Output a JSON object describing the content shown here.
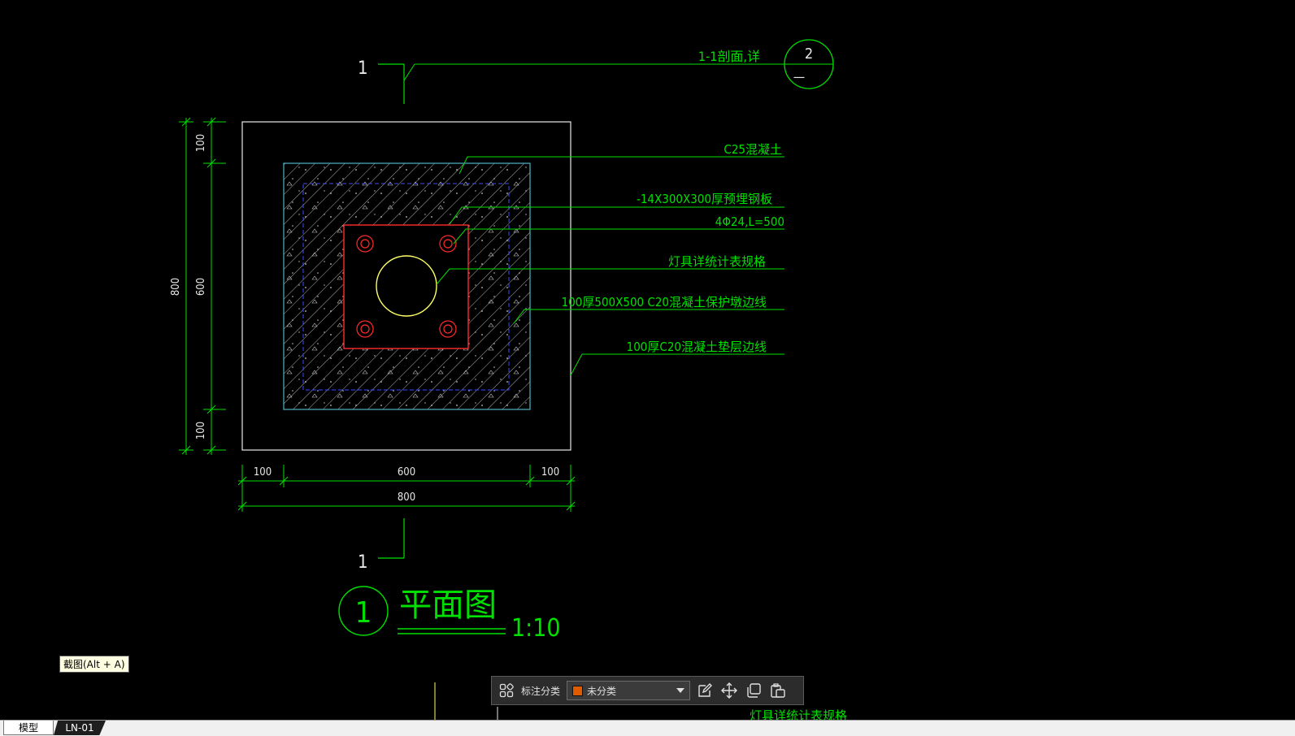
{
  "drawing": {
    "section_mark_top": "1",
    "section_mark_bottom": "1",
    "section_ref_text": "1-1剖面,详",
    "detail_circle_top": "2",
    "detail_circle_bottom": "—",
    "callouts": [
      "C25混凝土",
      "-14X300X300厚预埋钢板",
      "4Φ24,L=500",
      "灯具详统计表规格",
      "100厚500X500  C20混凝土保护墩边线",
      "100厚C20混凝土垫层边线"
    ],
    "dim_vertical": [
      "100",
      "600",
      "100"
    ],
    "dim_vertical_total": "800",
    "dim_horizontal": [
      "100",
      "600",
      "100"
    ],
    "dim_horizontal_total": "800",
    "title_number": "1",
    "title": "平面图",
    "scale": "1:10",
    "partial_bottom_text": "灯具详统计表规格"
  },
  "tooltip": {
    "text": "截图(Alt + A)"
  },
  "annotation_toolbar": {
    "category_label": "标注分类",
    "category_value": "未分类",
    "category_color": "#e05a00",
    "icons": [
      "grid-icon",
      "edit-icon",
      "move-icon",
      "copy-icon",
      "paste-icon"
    ]
  },
  "tabs": {
    "model": "模型",
    "layout": "LN-01"
  },
  "colors": {
    "background": "#000000",
    "annotation": "#00e000",
    "outline": "#e8e8e8",
    "hatch_border": "#4fb3c8",
    "dashed_line": "#3a4bff",
    "base_plate": "#ff2a2a",
    "pole": "#ffff66"
  }
}
